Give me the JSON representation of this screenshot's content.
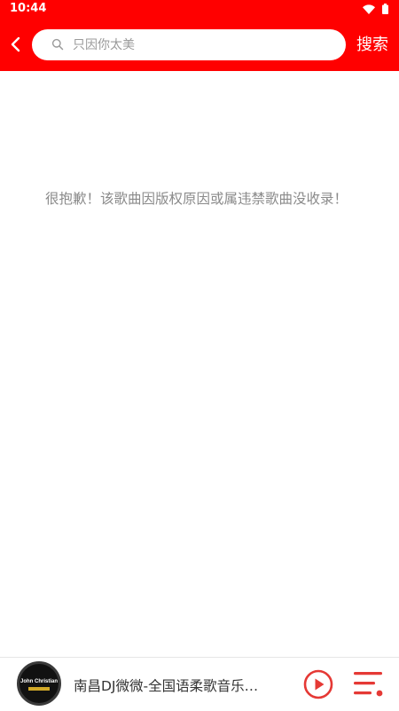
{
  "status_bar": {
    "time": "10:44"
  },
  "top_bar": {
    "back_icon": "back-chevron-icon",
    "search": {
      "placeholder": "只因你太美",
      "value": ""
    },
    "search_button_label": "搜索"
  },
  "content": {
    "empty_message": "很抱歉！该歌曲因版权原因或属违禁歌曲没收录！"
  },
  "player": {
    "album_art_text": "John Christian",
    "track_title": "南昌DJ微微-全国语柔歌音乐…",
    "play_icon": "play-circle-icon",
    "playlist_icon": "playlist-icon"
  },
  "colors": {
    "accent": "#ff0000",
    "player_icon": "#e53935",
    "empty_text": "#8a8a8a"
  }
}
